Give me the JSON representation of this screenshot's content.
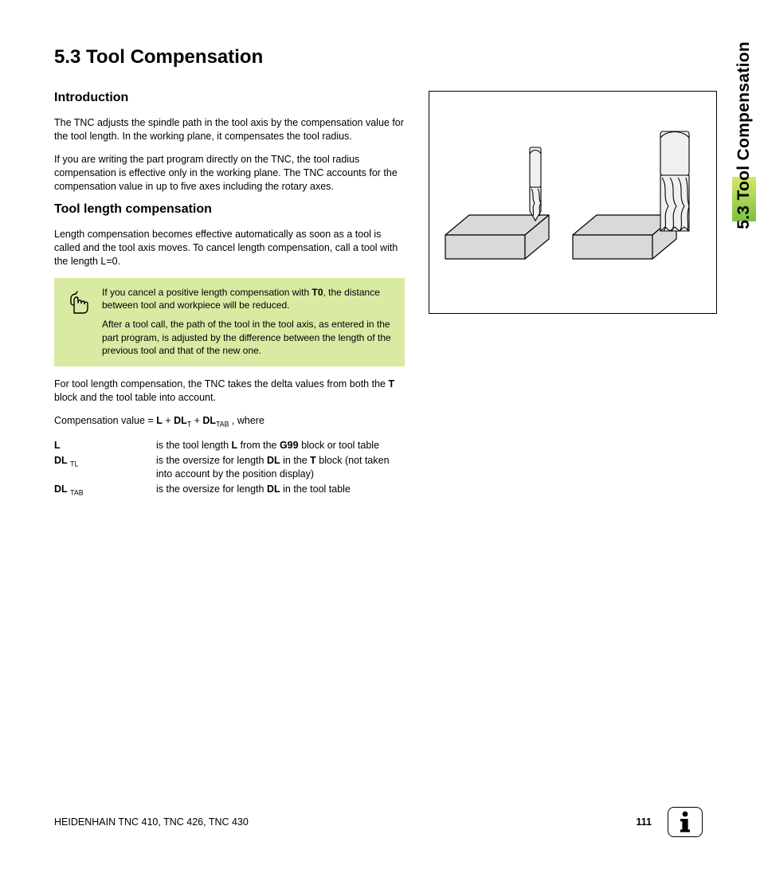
{
  "heading": "5.3  Tool Compensation",
  "side_tab": "5.3 Tool Compensation",
  "sections": {
    "intro_title": "Introduction",
    "intro_p1": "The TNC adjusts the spindle path in the tool axis by the compensation value for the tool length. In the working plane, it compensates the tool radius.",
    "intro_p2": "If you are writing the part program directly on the TNC, the tool radius compensation is effective only in the working plane. The TNC accounts for the compensation value in up to five axes including the rotary axes.",
    "tlc_title": "Tool length compensation",
    "tlc_p1": "Length compensation becomes effective automatically as soon as a tool is called and the tool axis moves. To cancel length compensation, call a tool with the length L=0.",
    "note_p1a": "If you cancel a positive length compensation with ",
    "note_p1_bold": "T0",
    "note_p1b": ", the distance between tool and workpiece will be reduced.",
    "note_p2": "After a tool call, the path of the tool in the tool axis, as entered in the part program, is adjusted by the difference between the length of the previous tool and that of the new one.",
    "tlc_p2a": "For tool length compensation, the TNC takes the delta values from both the ",
    "tlc_p2_bold": "T",
    "tlc_p2b": " block and the tool table into account.",
    "eq_lead": "Compensation value = ",
    "eq_L": "L",
    "eq_plus1": " + ",
    "eq_DL": "DL",
    "eq_subT": "T",
    "eq_plus2": " + ",
    "eq_DL2": "DL",
    "eq_subTAB": "TAB",
    "eq_where": " , where"
  },
  "defs": {
    "row1_term": "L",
    "row1_desc_a": "is the tool length ",
    "row1_desc_bold1": "L",
    "row1_desc_b": " from the ",
    "row1_desc_bold2": "G99",
    "row1_desc_c": " block or tool table",
    "row2_term_a": "DL",
    "row2_term_sub": "TL",
    "row2_desc_a": "is the oversize for length ",
    "row2_desc_bold1": "DL",
    "row2_desc_b": " in the ",
    "row2_desc_bold2": "T",
    "row2_desc_c": " block (not taken into account by the position display)",
    "row3_term_a": "DL",
    "row3_term_sub": "TAB",
    "row3_desc_a": "is the oversize for length ",
    "row3_desc_bold": "DL",
    "row3_desc_b": " in the tool table"
  },
  "footer": {
    "left": "HEIDENHAIN TNC 410, TNC 426, TNC 430",
    "page": "111"
  }
}
